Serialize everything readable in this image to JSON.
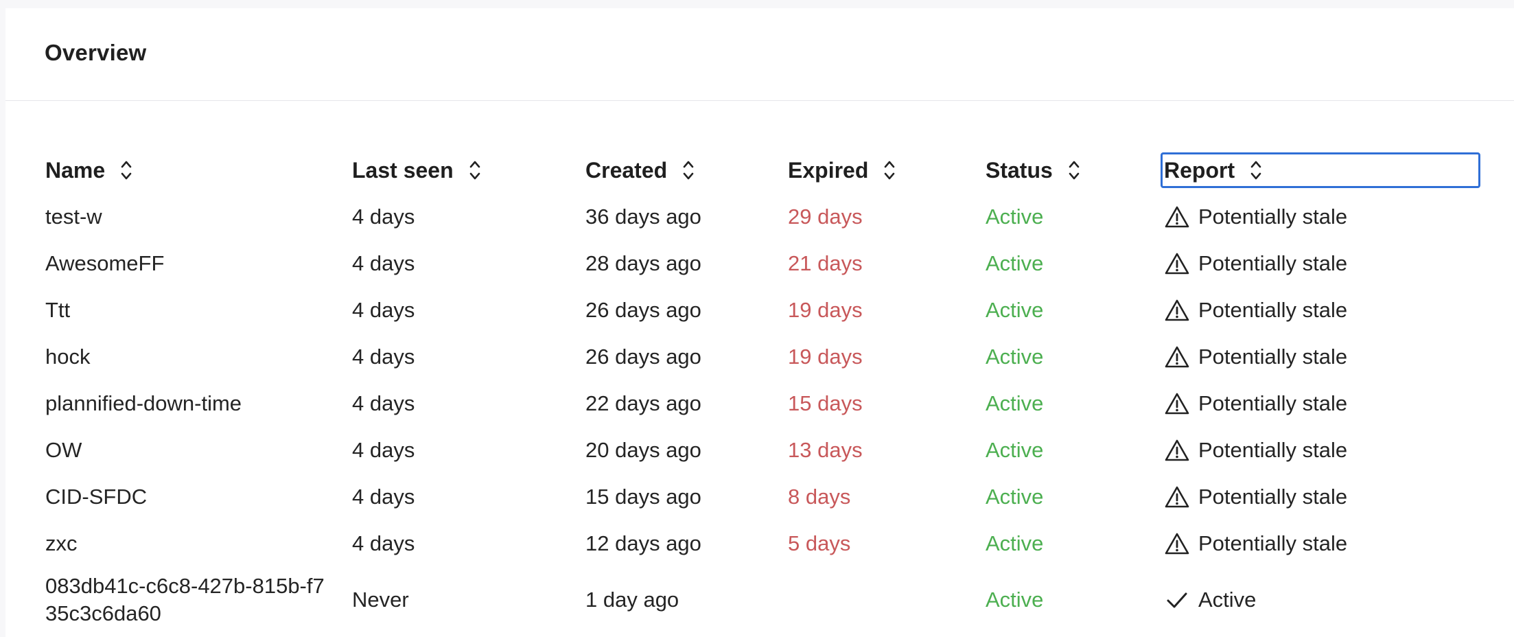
{
  "panel": {
    "title": "Overview"
  },
  "table": {
    "columns": [
      {
        "key": "name",
        "label": "Name"
      },
      {
        "key": "last_seen",
        "label": "Last seen"
      },
      {
        "key": "created",
        "label": "Created"
      },
      {
        "key": "expired",
        "label": "Expired"
      },
      {
        "key": "status",
        "label": "Status"
      },
      {
        "key": "report",
        "label": "Report"
      }
    ],
    "rows": [
      {
        "name": "test-w",
        "last_seen": "4 days",
        "created": "36 days ago",
        "expired": "29 days",
        "status": "Active",
        "report": "Potentially stale",
        "report_icon": "warning-triangle-icon"
      },
      {
        "name": "AwesomeFF",
        "last_seen": "4 days",
        "created": "28 days ago",
        "expired": "21 days",
        "status": "Active",
        "report": "Potentially stale",
        "report_icon": "warning-triangle-icon"
      },
      {
        "name": "Ttt",
        "last_seen": "4 days",
        "created": "26 days ago",
        "expired": "19 days",
        "status": "Active",
        "report": "Potentially stale",
        "report_icon": "warning-triangle-icon"
      },
      {
        "name": "hock",
        "last_seen": "4 days",
        "created": "26 days ago",
        "expired": "19 days",
        "status": "Active",
        "report": "Potentially stale",
        "report_icon": "warning-triangle-icon"
      },
      {
        "name": "plannified-down-time",
        "last_seen": "4 days",
        "created": "22 days ago",
        "expired": "15 days",
        "status": "Active",
        "report": "Potentially stale",
        "report_icon": "warning-triangle-icon"
      },
      {
        "name": "OW",
        "last_seen": "4 days",
        "created": "20 days ago",
        "expired": "13 days",
        "status": "Active",
        "report": "Potentially stale",
        "report_icon": "warning-triangle-icon"
      },
      {
        "name": "CID-SFDC",
        "last_seen": "4 days",
        "created": "15 days ago",
        "expired": "8 days",
        "status": "Active",
        "report": "Potentially stale",
        "report_icon": "warning-triangle-icon"
      },
      {
        "name": "zxc",
        "last_seen": "4 days",
        "created": "12 days ago",
        "expired": "5 days",
        "status": "Active",
        "report": "Potentially stale",
        "report_icon": "warning-triangle-icon"
      },
      {
        "name": "083db41c-c6c8-427b-815b-f735c3c6da60",
        "last_seen": "Never",
        "created": "1 day ago",
        "expired": "",
        "status": "Active",
        "report": "Active",
        "report_icon": "check-icon"
      }
    ]
  },
  "colors": {
    "expired": "#c8585a",
    "status_active": "#4caf50",
    "focus_outline": "#2f6fd6"
  }
}
